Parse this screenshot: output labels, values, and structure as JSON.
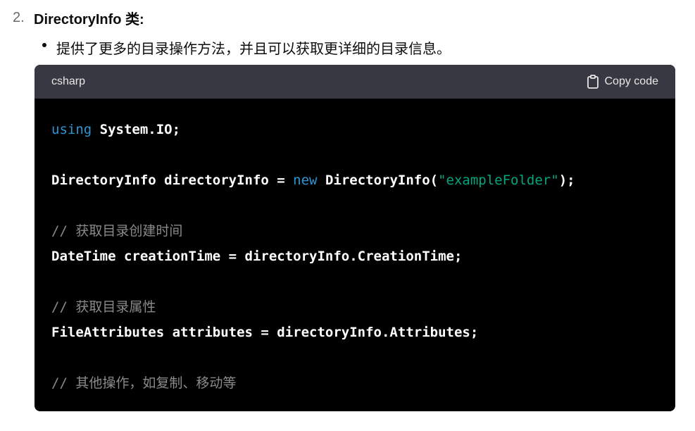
{
  "list": {
    "number": "2.",
    "heading": "DirectoryInfo 类:"
  },
  "bullet": {
    "text": "提供了更多的目录操作方法，并且可以获取更详细的目录信息。"
  },
  "code_block": {
    "language": "csharp",
    "copy_label": "Copy code",
    "lines": {
      "l1_kw": "using",
      "l1_rest": " System.IO;",
      "l2_a": "DirectoryInfo directoryInfo = ",
      "l2_kw": "new",
      "l2_b": " DirectoryInfo(",
      "l2_str": "\"exampleFolder\"",
      "l2_c": ");",
      "l3_cmt": "// 获取目录创建时间",
      "l4": "DateTime creationTime = directoryInfo.CreationTime;",
      "l5_cmt": "// 获取目录属性",
      "l6": "FileAttributes attributes = directoryInfo.Attributes;",
      "l7_cmt": "// 其他操作，如复制、移动等"
    }
  },
  "colors": {
    "keyword": "#2e95d3",
    "string": "#00a67d",
    "comment": "#8a8a8a",
    "code_bg": "#000000",
    "header_bg": "#383842"
  }
}
